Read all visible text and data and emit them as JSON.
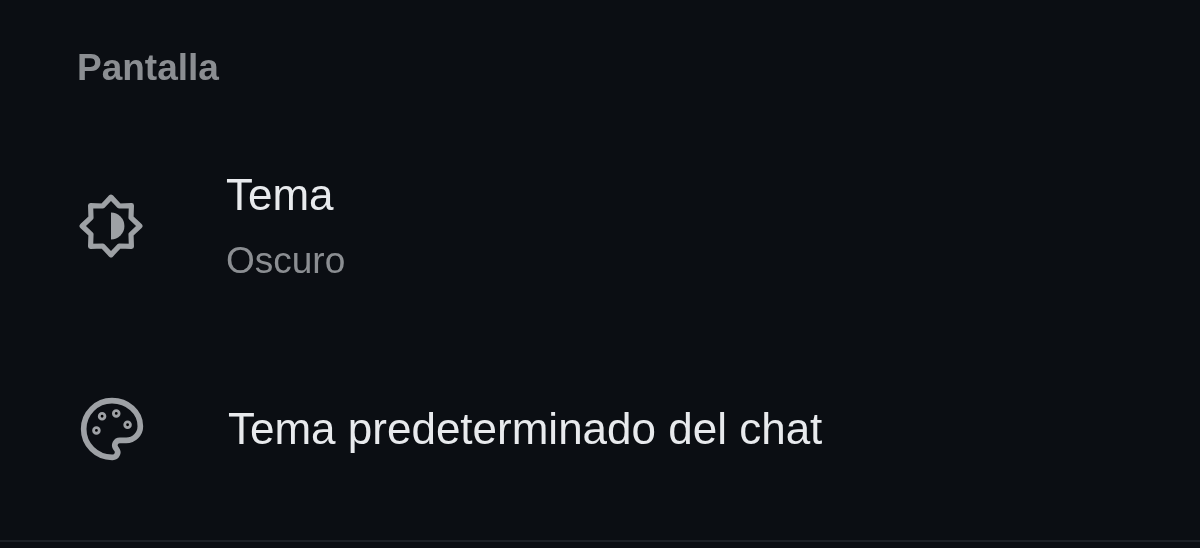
{
  "section": {
    "title": "Pantalla"
  },
  "items": [
    {
      "title": "Tema",
      "subtitle": "Oscuro"
    },
    {
      "title": "Tema predeterminado del chat"
    }
  ]
}
